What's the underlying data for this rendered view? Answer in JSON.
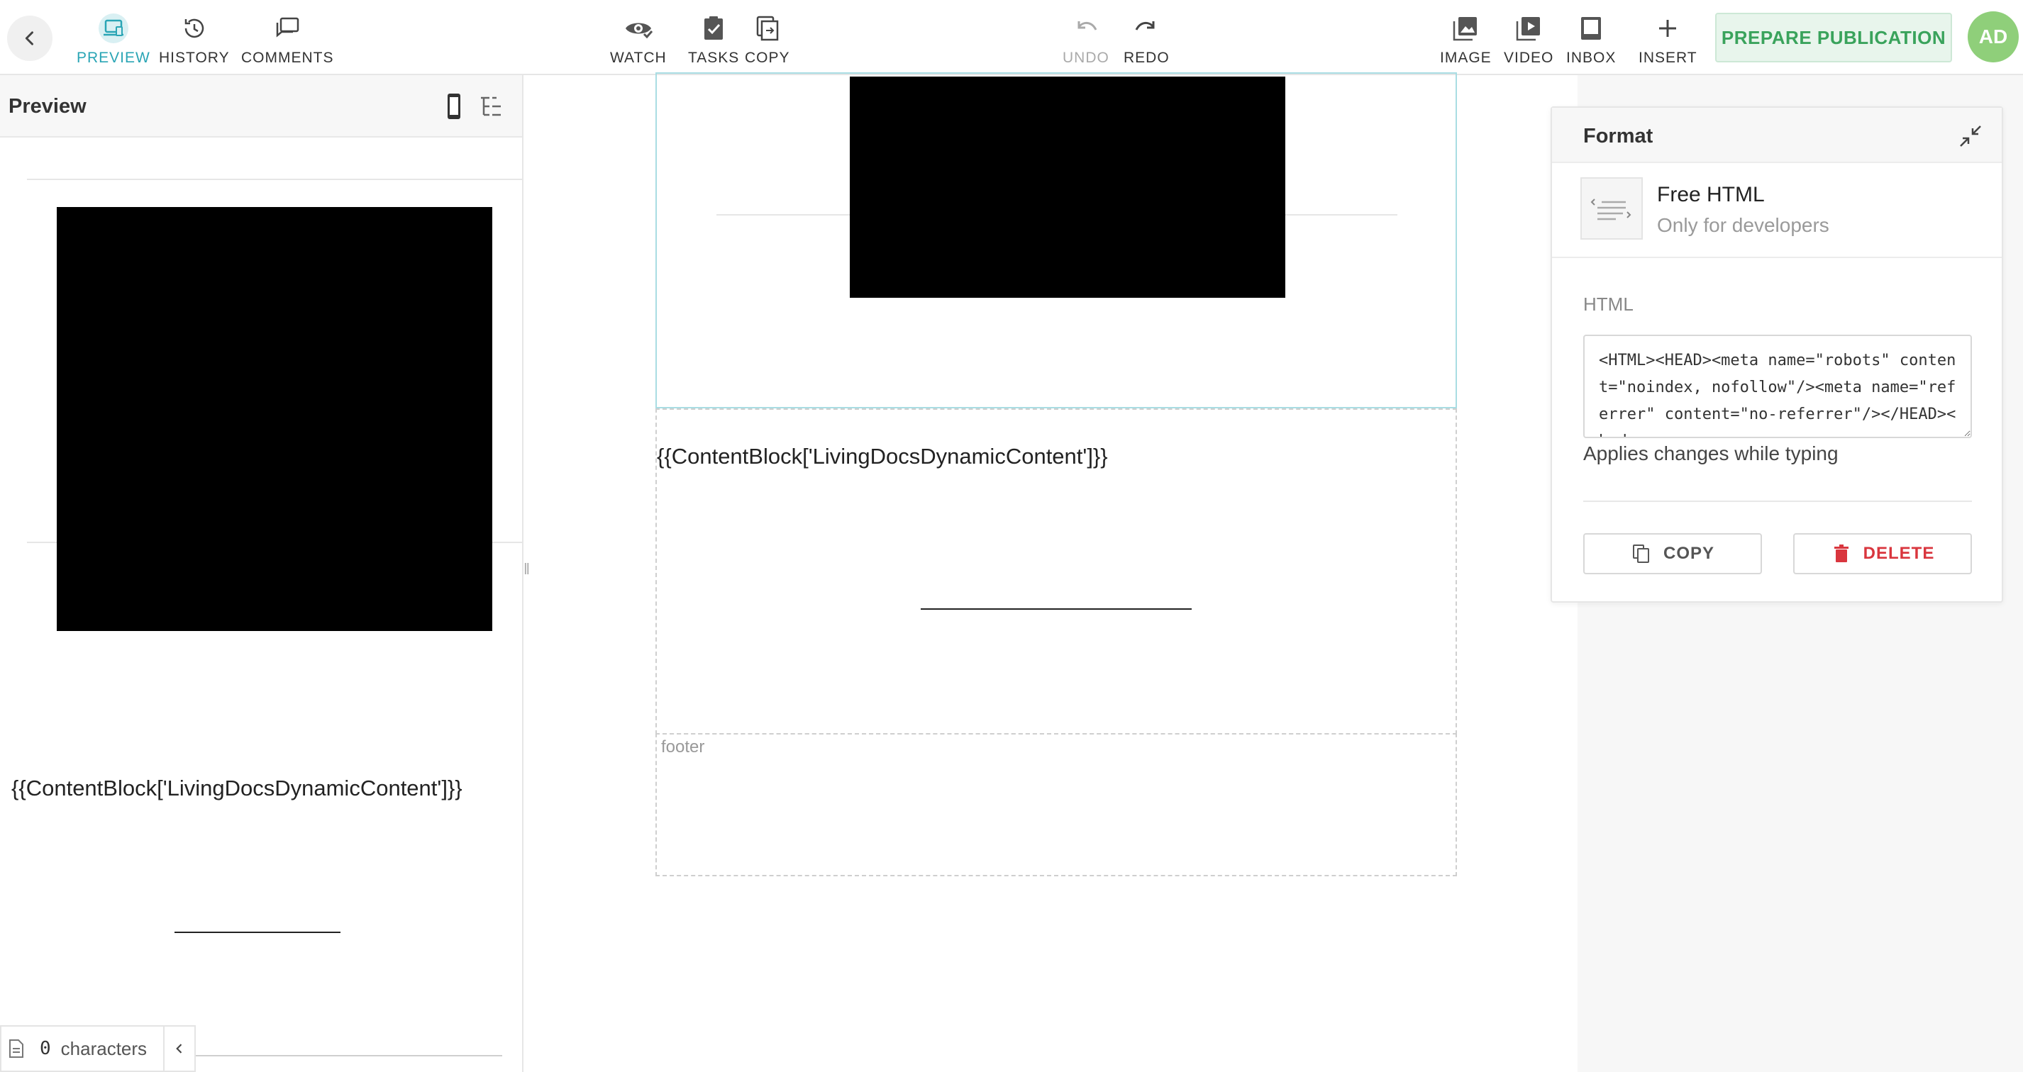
{
  "toolbar": {
    "left_tools": [
      {
        "label": "PREVIEW",
        "icon": "preview-icon",
        "active": true
      },
      {
        "label": "HISTORY",
        "icon": "history-icon"
      },
      {
        "label": "COMMENTS",
        "icon": "comments-icon"
      }
    ],
    "center_tools": [
      {
        "label": "WATCH",
        "icon": "eye-icon"
      },
      {
        "label": "TASKS",
        "icon": "clipboard-check-icon"
      },
      {
        "label": "COPY",
        "icon": "copy-icon"
      }
    ],
    "history_tools": [
      {
        "label": "UNDO",
        "icon": "undo-icon",
        "disabled": true
      },
      {
        "label": "REDO",
        "icon": "redo-icon"
      }
    ],
    "right_tools": [
      {
        "label": "IMAGE",
        "icon": "image-icon"
      },
      {
        "label": "VIDEO",
        "icon": "video-icon"
      },
      {
        "label": "INBOX",
        "icon": "inbox-icon"
      },
      {
        "label": "INSERT",
        "icon": "plus-icon"
      }
    ],
    "prepare_label": "PREPARE PUBLICATION",
    "avatar_initials": "AD"
  },
  "preview": {
    "title": "Preview",
    "dynamic_content": "{{ContentBlock['LivingDocsDynamicContent']}}",
    "char_count_value": "0",
    "char_count_label": "characters"
  },
  "canvas": {
    "dynamic_content": "{{ContentBlock['LivingDocsDynamicContent']}}",
    "footer_label": "footer"
  },
  "format_panel": {
    "title": "Format",
    "component_name": "Free HTML",
    "component_desc": "Only for developers",
    "html_label": "HTML",
    "html_value": "<HTML><HEAD><meta name=\"robots\" content=\"noindex, nofollow\"/><meta name=\"referrer\" content=\"no-referrer\"/></HEAD><body>",
    "applies_text": "Applies changes while typing",
    "copy_label": "COPY",
    "delete_label": "DELETE"
  },
  "colors": {
    "accent": "#2aa5b5",
    "publish_text": "#3aa35c",
    "publish_bg": "#e8f5ec",
    "avatar_bg": "#8fcf7a",
    "delete_red": "#d9363e",
    "selected_border": "#a9dde3"
  }
}
